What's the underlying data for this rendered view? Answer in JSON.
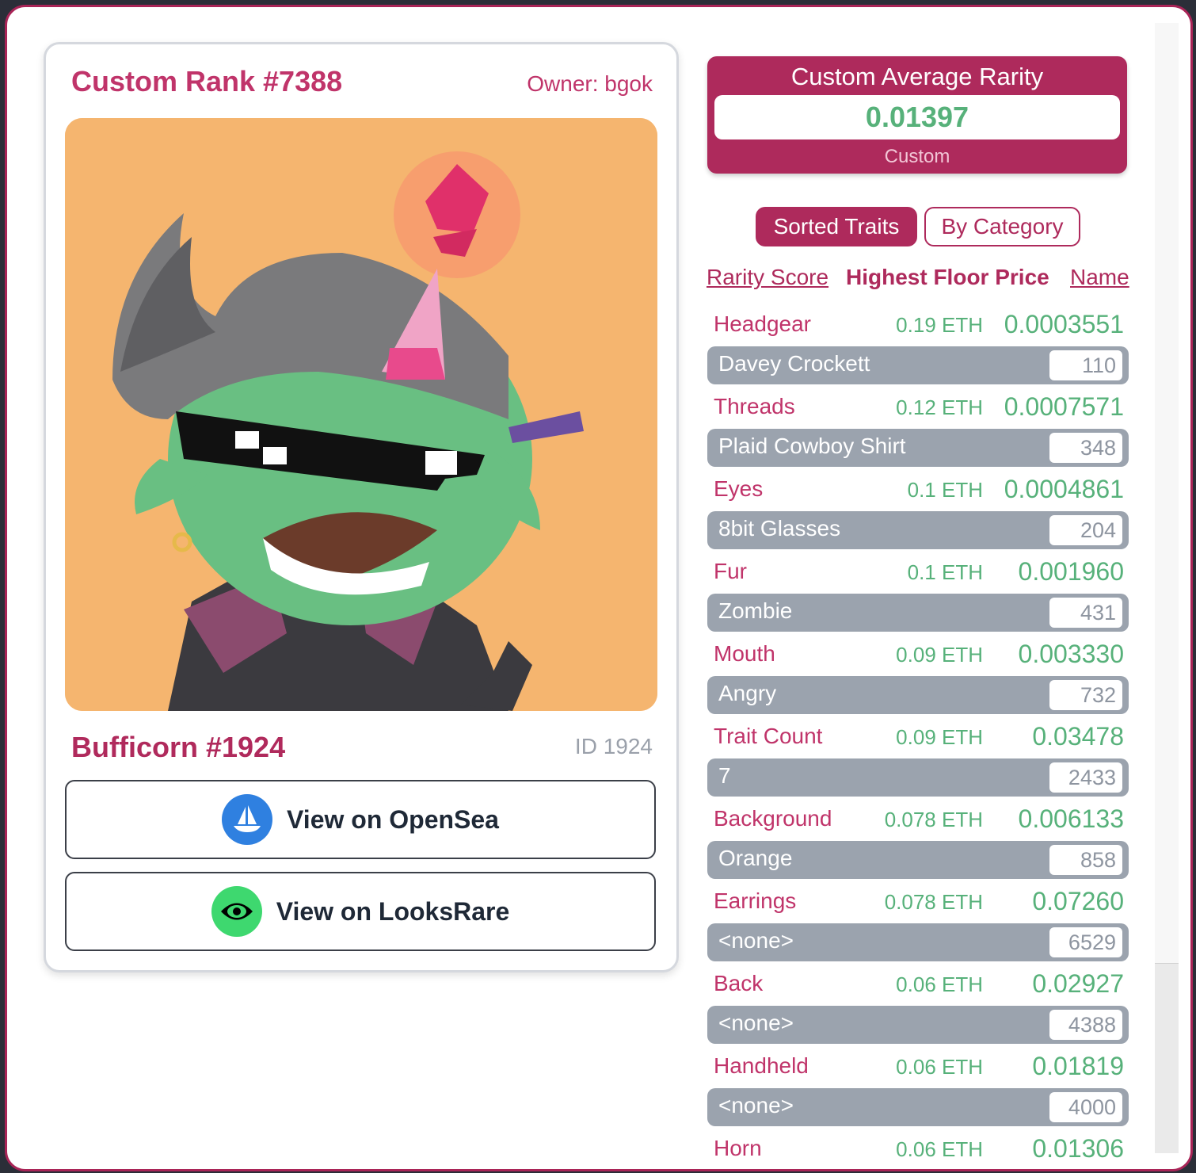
{
  "card": {
    "rank_title": "Custom Rank #7388",
    "owner": "Owner: bgok",
    "nft_name": "Bufficorn #1924",
    "token_id": "ID 1924",
    "opensea_label": "View on OpenSea",
    "looksrare_label": "View on LooksRare"
  },
  "rarity": {
    "title": "Custom Average Rarity",
    "value": "0.01397",
    "subtitle": "Custom"
  },
  "toggles": {
    "sorted": "Sorted Traits",
    "category": "By Category"
  },
  "sort": {
    "rarity_score": "Rarity Score",
    "highest_floor": "Highest Floor Price",
    "name": "Name"
  },
  "colors": {
    "accent": "#ae2a5c",
    "value_green": "#57b17a",
    "bar_gray": "#9ba3ae",
    "image_background": "#f5b56f"
  },
  "traits": [
    {
      "category": "Headgear",
      "floor": "0.19 ETH",
      "score": "0.0003551",
      "value": "Davey Crockett",
      "count": "110"
    },
    {
      "category": "Threads",
      "floor": "0.12 ETH",
      "score": "0.0007571",
      "value": "Plaid Cowboy Shirt",
      "count": "348"
    },
    {
      "category": "Eyes",
      "floor": "0.1 ETH",
      "score": "0.0004861",
      "value": "8bit Glasses",
      "count": "204"
    },
    {
      "category": "Fur",
      "floor": "0.1 ETH",
      "score": "0.001960",
      "value": "Zombie",
      "count": "431"
    },
    {
      "category": "Mouth",
      "floor": "0.09 ETH",
      "score": "0.003330",
      "value": "Angry",
      "count": "732"
    },
    {
      "category": "Trait Count",
      "floor": "0.09 ETH",
      "score": "0.03478",
      "value": "7",
      "count": "2433"
    },
    {
      "category": "Background",
      "floor": "0.078 ETH",
      "score": "0.006133",
      "value": "Orange",
      "count": "858"
    },
    {
      "category": "Earrings",
      "floor": "0.078 ETH",
      "score": "0.07260",
      "value": "<none>",
      "count": "6529"
    },
    {
      "category": "Back",
      "floor": "0.06 ETH",
      "score": "0.02927",
      "value": "<none>",
      "count": "4388"
    },
    {
      "category": "Handheld",
      "floor": "0.06 ETH",
      "score": "0.01819",
      "value": "<none>",
      "count": "4000"
    },
    {
      "category": "Horn",
      "floor": "0.06 ETH",
      "score": "0.01306",
      "value": "",
      "count": ""
    }
  ]
}
